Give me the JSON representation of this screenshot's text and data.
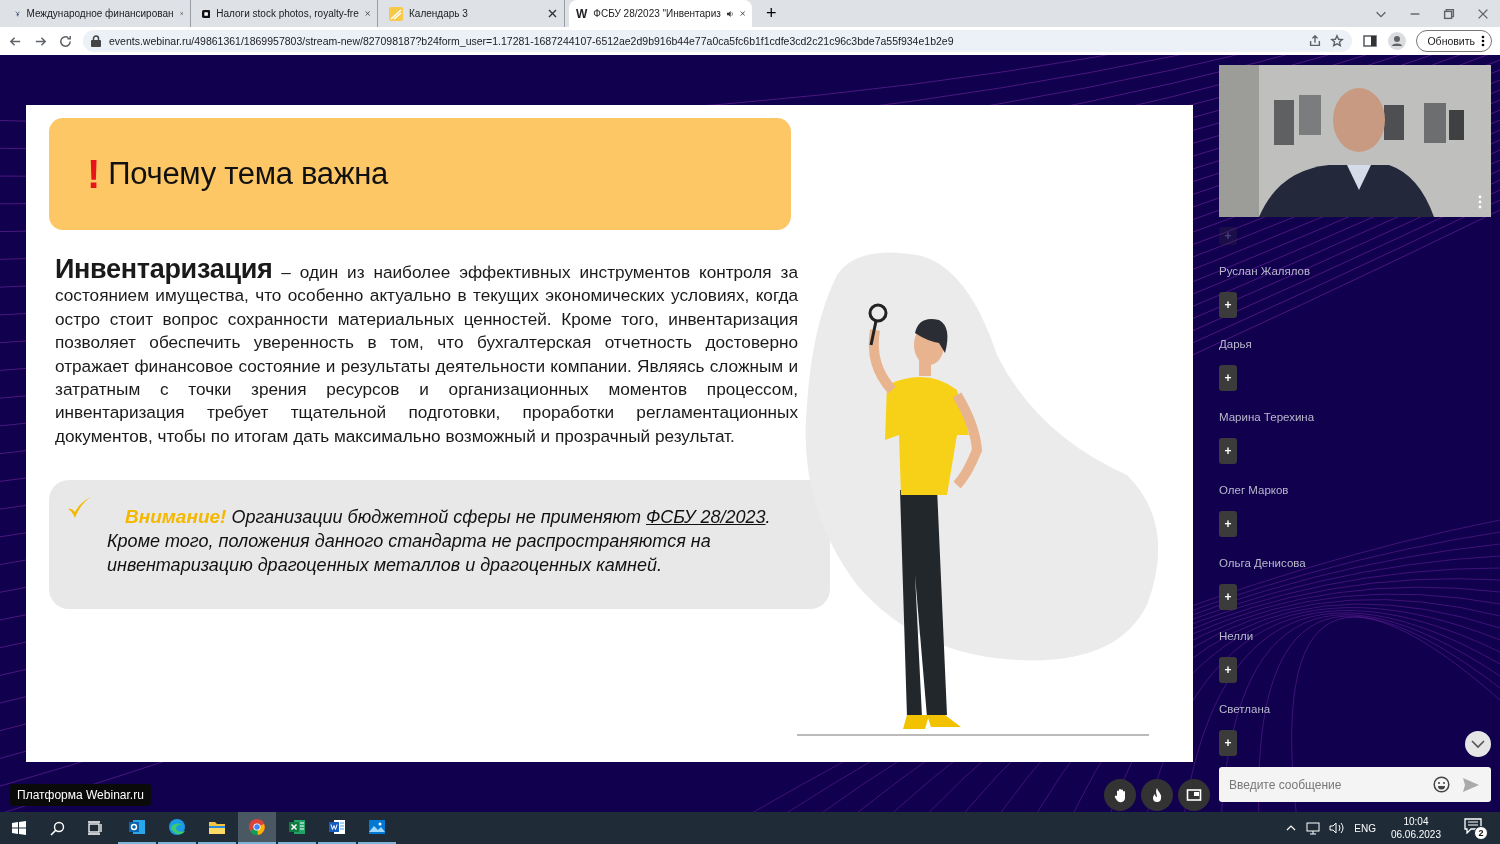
{
  "browser": {
    "tabs": [
      {
        "title": "Международное финансирован",
        "kind": "figure",
        "selected": false,
        "audio": false
      },
      {
        "title": "Налоги stock photos, royalty-fre",
        "kind": "stock",
        "selected": false,
        "audio": false
      },
      {
        "title": "Календарь 3",
        "kind": "calendar",
        "selected": false,
        "audio": false
      },
      {
        "title": "ФСБУ 28/2023 \"Инвентариз",
        "kind": "letter",
        "favicon_text": "W",
        "selected": true,
        "audio": true
      }
    ],
    "new_tab": "+",
    "url": "events.webinar.ru/49861361/1869957803/stream-new/827098187?b24form_user=1.17281-1687244107-6512ae2d9b916b44e77a0ca5fc6b1f1cdfe3cd2c21c96c3bde7a55f934e1b2e9",
    "update_button": "Обновить"
  },
  "slide": {
    "header_mark": "!",
    "title": "Почему тема важна",
    "lead": "Инвентаризация",
    "body": " – один из наиболее эффективных инструментов контроля за состоянием имущества, что особенно актуально в текущих экономических условиях, когда остро стоит вопрос сохранности материальных ценностей. Кроме того, инвентаризация позволяет обеспечить уверенность в том, что бухгалтерская отчетность достоверно отражает финансовое состояние и результаты деятельности компании. Являясь сложным и затратным с точки зрения ресурсов и организационных моментов процессом, инвентаризация требует тщательной подготовки, проработки регламентационных документов, чтобы по итогам дать максимально возможный и прозрачный результат.",
    "note": {
      "label": "Внимание!",
      "text_before": " Организации бюджетной сферы не применяют ",
      "link": "ФСБУ 28/2023",
      "text_after": ".",
      "second": "Кроме того, положения данного стандарта не распространяются на инвентаризацию драгоценных металлов и драгоценных камней."
    }
  },
  "participants": [
    {
      "faded": true,
      "add_label": "+"
    },
    {
      "name": "Руслан Жалялов",
      "faded": false,
      "add_label": "+"
    },
    {
      "name": "Дарья",
      "faded": false,
      "add_label": "+"
    },
    {
      "name": "Марина Терехина",
      "faded": false,
      "add_label": "+"
    },
    {
      "name": "Олег Марков",
      "faded": false,
      "add_label": "+"
    },
    {
      "name": "Ольга Денисова",
      "faded": false,
      "add_label": "+"
    },
    {
      "name": "Нелли",
      "faded": false,
      "add_label": "+"
    },
    {
      "name": "Светлана",
      "faded": false,
      "add_label": "+"
    }
  ],
  "platform_label": "Платформа Webinar.ru",
  "controls": [
    {
      "kind": "hand"
    },
    {
      "kind": "fire"
    },
    {
      "kind": "pip"
    }
  ],
  "chat": {
    "placeholder": "Введите сообщение"
  },
  "taskbar": {
    "apps": [
      {
        "kind": "mail",
        "selected": false
      },
      {
        "kind": "edge",
        "selected": false
      },
      {
        "kind": "folder",
        "selected": false
      },
      {
        "kind": "chrome",
        "selected": true
      },
      {
        "kind": "sheet",
        "selected": false
      },
      {
        "kind": "doc",
        "selected": false
      },
      {
        "kind": "photos",
        "selected": false
      }
    ],
    "language": "ENG",
    "time": "10:04",
    "date": "06.06.2023",
    "notifications": "2"
  }
}
